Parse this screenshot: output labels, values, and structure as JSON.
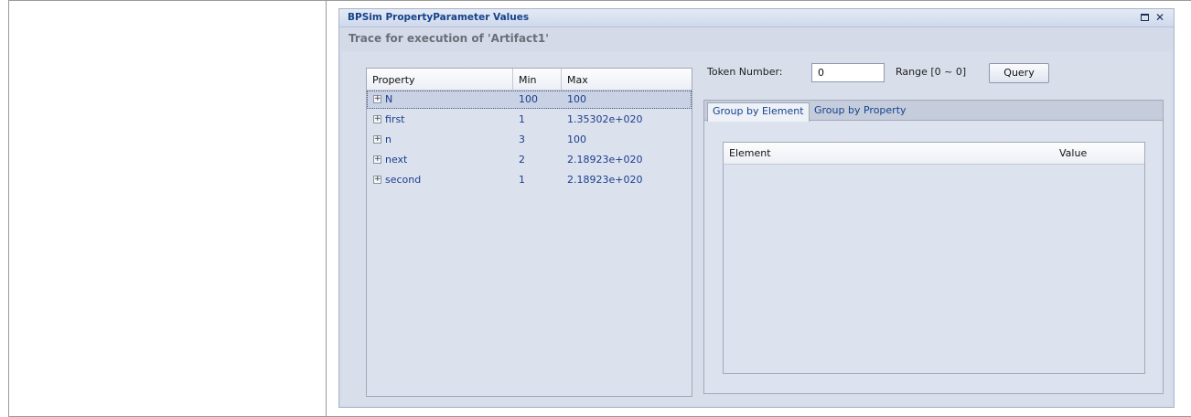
{
  "window": {
    "title": "BPSim PropertyParameter Values",
    "maximize_glyph": "",
    "close_glyph": "✕"
  },
  "trace_heading": "Trace for execution of 'Artifact1'",
  "property_grid": {
    "columns": [
      "Property",
      "Min",
      "Max"
    ],
    "expander_glyph": "+",
    "rows": [
      {
        "name": "N",
        "min": "100",
        "max": "100"
      },
      {
        "name": "first",
        "min": "1",
        "max": "1.35302e+020"
      },
      {
        "name": "n",
        "min": "3",
        "max": "100"
      },
      {
        "name": "next",
        "min": "2",
        "max": "2.18923e+020"
      },
      {
        "name": "second",
        "min": "1",
        "max": "2.18923e+020"
      }
    ]
  },
  "token": {
    "label": "Token Number:",
    "value": "0",
    "range_label": "Range [0 ~ 0]",
    "query_label": "Query"
  },
  "tabs": {
    "active": "Group by Element",
    "inactive": "Group by Property"
  },
  "element_grid": {
    "columns": [
      "Element",
      "Value"
    ]
  }
}
